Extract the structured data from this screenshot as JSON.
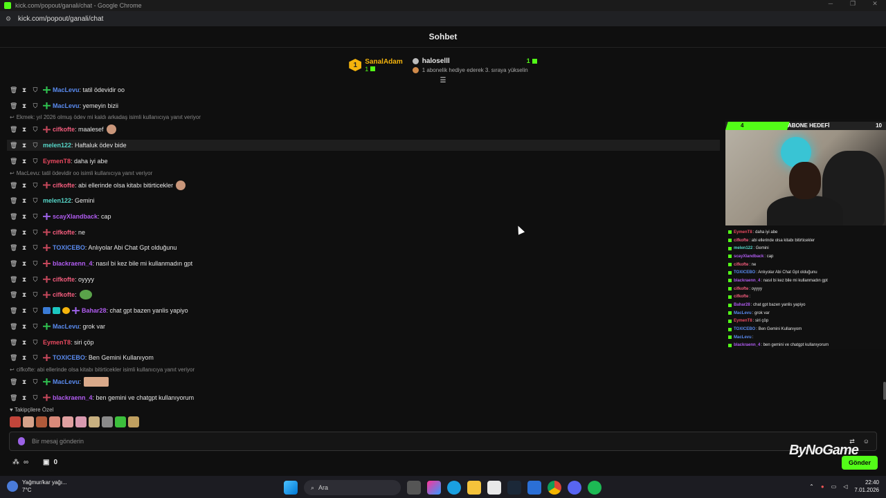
{
  "window": {
    "title": "kick.com/popout/ganali/chat - Google Chrome",
    "url": "kick.com/popout/ganali/chat"
  },
  "header": {
    "title": "Sohbet"
  },
  "leaderboard": {
    "first": {
      "rank": "1",
      "name": "SanalAdam",
      "count": "1"
    },
    "second": {
      "name": "haloselll",
      "count": "1",
      "hint": "1 abonelik hediye ederek 3. sıraya yükselin"
    }
  },
  "colors": {
    "green": "#53fc18",
    "blue": "#5a8bf0",
    "red": "#e8495f",
    "pink": "#f55d7e",
    "teal": "#56d7c9",
    "purple": "#b05cf0",
    "orange": "#f5b40c"
  },
  "chat": [
    {
      "type": "msg",
      "user": "MacLevu",
      "color": "#5a8bf0",
      "badge": "green",
      "text": ": tatil ödevidir oo"
    },
    {
      "type": "msg",
      "user": "MacLevu",
      "color": "#5a8bf0",
      "badge": "green",
      "text": ": yemeyin bizii"
    },
    {
      "type": "reply",
      "text": "Ekmek: yıl 2026 olmuş ödev mi kaldı arkadaş isimli kullanıcıya yanıt veriyor"
    },
    {
      "type": "msg",
      "user": "cifkofte",
      "color": "#f55d7e",
      "badge": "red",
      "text": ": maalesef",
      "emote": true
    },
    {
      "type": "msg",
      "user": "melen122",
      "color": "#56d7c9",
      "badge": "",
      "text": ": Haftaluk ödev bide",
      "hl": true
    },
    {
      "type": "msg",
      "user": "EymenT8",
      "color": "#e8495f",
      "badge": "",
      "text": ": daha iyi abe"
    },
    {
      "type": "reply",
      "text": "MacLevu: tatil ödevidir oo isimli kullanıcıya yanıt veriyor"
    },
    {
      "type": "msg",
      "user": "cifkofte",
      "color": "#f55d7e",
      "badge": "red",
      "text": ": abi ellerinde olsa kitabı bitirticekler",
      "emote": true
    },
    {
      "type": "msg",
      "user": "melen122",
      "color": "#56d7c9",
      "badge": "",
      "text": ": Gemini"
    },
    {
      "type": "msg",
      "user": "scayXlandback",
      "color": "#b05cf0",
      "badge": "purple",
      "text": ": cap"
    },
    {
      "type": "msg",
      "user": "cifkofte",
      "color": "#f55d7e",
      "badge": "red",
      "text": ": ne"
    },
    {
      "type": "msg",
      "user": "TOXICEBO",
      "color": "#5a8bf0",
      "badge": "red",
      "text": ": Anlıyolar Abi Chat Gpt olduğunu"
    },
    {
      "type": "msg",
      "user": "blackraenn_4",
      "color": "#b05cf0",
      "badge": "red",
      "text": ": nasıl bi kez bile mi kullanmadın gpt"
    },
    {
      "type": "msg",
      "user": "cifkofte",
      "color": "#f55d7e",
      "badge": "red",
      "text": ": oyyyy"
    },
    {
      "type": "msg",
      "user": "cifkofte",
      "color": "#f55d7e",
      "badge": "red",
      "text": ":",
      "emote": "frog"
    },
    {
      "type": "msg",
      "user": "Bahar28",
      "color": "#b05cf0",
      "badge": "multi",
      "text": ": chat gpt bazen yanlis yapiyo"
    },
    {
      "type": "msg",
      "user": "MacLevu",
      "color": "#5a8bf0",
      "badge": "green",
      "text": ": grok var"
    },
    {
      "type": "msg",
      "user": "EymenT8",
      "color": "#e8495f",
      "badge": "",
      "text": ": siri çöp"
    },
    {
      "type": "msg",
      "user": "TOXICEBO",
      "color": "#5a8bf0",
      "badge": "red",
      "text": ": Ben Gemini Kullanıyom"
    },
    {
      "type": "reply",
      "text": "cifkofte: abi ellerinde olsa kitabı bitirticekler   isimli kullanıcıya yanıt veriyor"
    },
    {
      "type": "msg",
      "user": "MacLevu",
      "color": "#5a8bf0",
      "badge": "green",
      "text": ":",
      "emote": "big"
    },
    {
      "type": "msg",
      "user": "blackraenn_4",
      "color": "#b05cf0",
      "badge": "red",
      "text": ": ben gemini ve chatgpt kullanıyorum"
    }
  ],
  "followers_label": "Takipçilere Özel",
  "input": {
    "placeholder": "Bir mesaj gönderin"
  },
  "bottom": {
    "points": "∞",
    "count": "0",
    "send": "Gönder"
  },
  "watermark": "ByNoGame",
  "overlay": {
    "goal": {
      "current": "4",
      "title": "ABONE HEDEFİ",
      "target": "10",
      "fraction": 0.4
    },
    "lines": [
      {
        "user": "EymenT8",
        "color": "#e8495f",
        "text": ": daha iyi abe"
      },
      {
        "user": "cifkofte",
        "color": "#f55d7e",
        "text": ": abi ellerinde olsa kitabı bitirticekler"
      },
      {
        "user": "melen122",
        "color": "#56d7c9",
        "text": ": Gemini"
      },
      {
        "user": "scayXlandback",
        "color": "#b05cf0",
        "text": ": cap"
      },
      {
        "user": "cifkofte",
        "color": "#f55d7e",
        "text": ": ne"
      },
      {
        "user": "TOXICEBO",
        "color": "#5a8bf0",
        "text": ": Anlıyolar Abi Chat Gpt olduğunu"
      },
      {
        "user": "blackraenn_4",
        "color": "#b05cf0",
        "text": ": nasıl bi kez bile mi kullanmadın gpt"
      },
      {
        "user": "cifkofte",
        "color": "#f55d7e",
        "text": ": oyyyy"
      },
      {
        "user": "cifkofte",
        "color": "#f55d7e",
        "text": ":"
      },
      {
        "user": "Bahar28",
        "color": "#b05cf0",
        "text": ": chat gpt bazen yanlis yapiyo"
      },
      {
        "user": "MacLevu",
        "color": "#5a8bf0",
        "text": ": grok var"
      },
      {
        "user": "EymenT8",
        "color": "#e8495f",
        "text": ": siri çöp"
      },
      {
        "user": "TOXICEBO",
        "color": "#5a8bf0",
        "text": ": Ben Gemini Kullanıyom"
      },
      {
        "user": "MacLevu",
        "color": "#5a8bf0",
        "text": ":"
      },
      {
        "user": "blackraenn_4",
        "color": "#b05cf0",
        "text": ": ben gemini ve chatgpt kullanıyorum"
      }
    ]
  },
  "taskbar": {
    "weather_title": "Yağmur/kar yağı...",
    "weather_temp": "7°C",
    "search": "Ara",
    "time": "22:40",
    "date": "7.01.2026"
  }
}
